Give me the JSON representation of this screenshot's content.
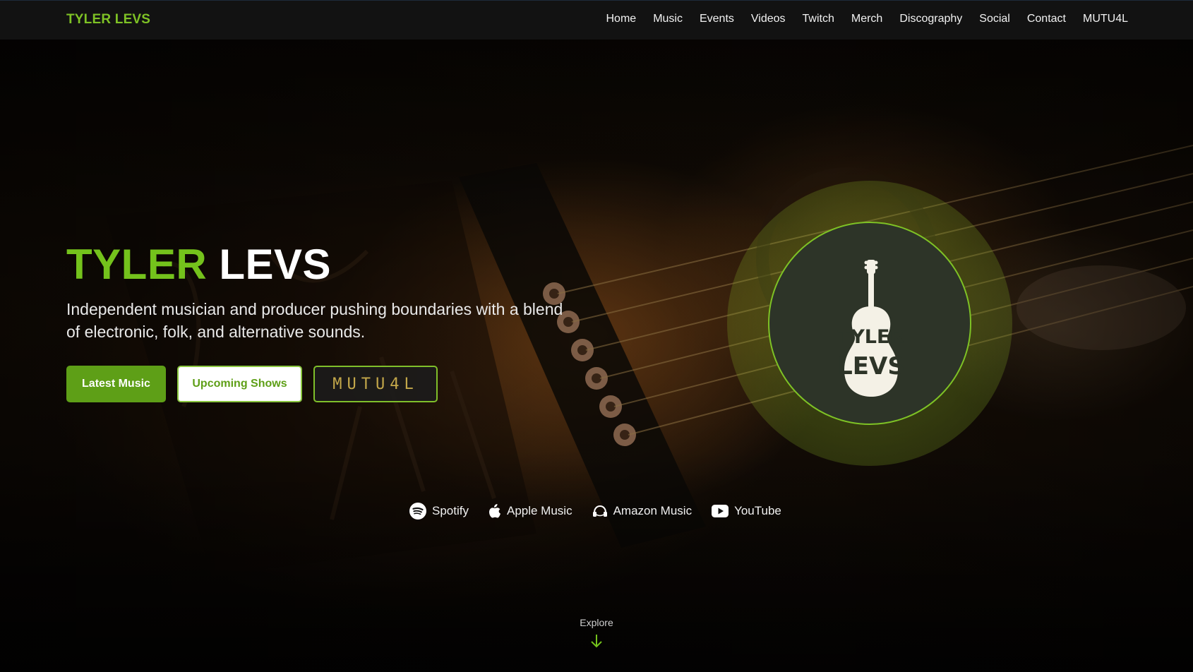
{
  "brand": "TYLER LEVS",
  "nav": [
    "Home",
    "Music",
    "Events",
    "Videos",
    "Twitch",
    "Merch",
    "Discography",
    "Social",
    "Contact",
    "MUTU4L"
  ],
  "hero": {
    "title_first": "TYLER",
    "title_last": "LEVS",
    "subtitle": "Independent musician and producer pushing boundaries with a blend of electronic, folk, and alternative sounds."
  },
  "buttons": {
    "latest": "Latest Music",
    "shows": "Upcoming Shows",
    "mutual": "MUTU4L"
  },
  "logo": {
    "line1": "TYLER",
    "line2": "LEVS"
  },
  "streaming": [
    {
      "label": "Spotify",
      "icon": "spotify-icon"
    },
    {
      "label": "Apple Music",
      "icon": "apple-icon"
    },
    {
      "label": "Amazon Music",
      "icon": "amazon-music-icon"
    },
    {
      "label": "YouTube",
      "icon": "youtube-icon"
    }
  ],
  "explore": "Explore",
  "colors": {
    "accent": "#74c21c",
    "button_green": "#5e9f17",
    "nav_bg": "#121212"
  }
}
